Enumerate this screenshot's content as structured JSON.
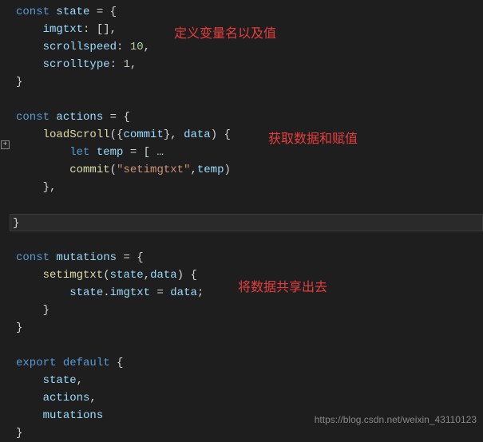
{
  "code": {
    "l1_const": "const",
    "l1_state": "state",
    "l1_eq": " = {",
    "l2_imgtxt": "imgtxt",
    "l2_val": ": [],",
    "l3_scrollspeed": "scrollspeed",
    "l3_colon": ": ",
    "l3_num": "10",
    "l3_comma": ",",
    "l4_scrolltype": "scrolltype",
    "l4_colon": ": ",
    "l4_num": "1",
    "l4_comma": ",",
    "l5_close": "}",
    "l7_const": "const",
    "l7_actions": "actions",
    "l7_eq": " = {",
    "l8_loadScroll": "loadScroll",
    "l8_open": "({",
    "l8_commit": "commit",
    "l8_close": "}, ",
    "l8_data": "data",
    "l8_end": ") {",
    "l9_let": "let",
    "l9_temp": " temp",
    "l9_eq": " = [",
    "l9_dots": " …",
    "l10_commit": "commit",
    "l10_open": "(",
    "l10_str": "\"setimgtxt\"",
    "l10_sep": ",",
    "l10_temp": "temp",
    "l10_close": ")",
    "l11_close": "},",
    "l13_close": "}",
    "l15_const": "const",
    "l15_mutations": "mutations",
    "l15_eq": " = {",
    "l16_setimgtxt": "setimgtxt",
    "l16_open": "(",
    "l16_state": "state",
    "l16_sep": ",",
    "l16_data": "data",
    "l16_close": ") {",
    "l17_state": "state",
    "l17_dot": ".",
    "l17_imgtxt": "imgtxt",
    "l17_eq": " = ",
    "l17_data": "data",
    "l17_semi": ";",
    "l18_close": "}",
    "l19_close": "}",
    "l21_export": "export",
    "l21_default": "default",
    "l21_open": " {",
    "l22_state": "state",
    "l22_comma": ",",
    "l23_actions": "actions",
    "l23_comma": ",",
    "l24_mutations": "mutations",
    "l25_close": "}"
  },
  "annotations": {
    "ann1": "定义变量名以及值",
    "ann2": "获取数据和赋值",
    "ann3": "将数据共享出去"
  },
  "watermark": "https://blog.csdn.net/weixin_43110123",
  "fold_glyph": "+"
}
